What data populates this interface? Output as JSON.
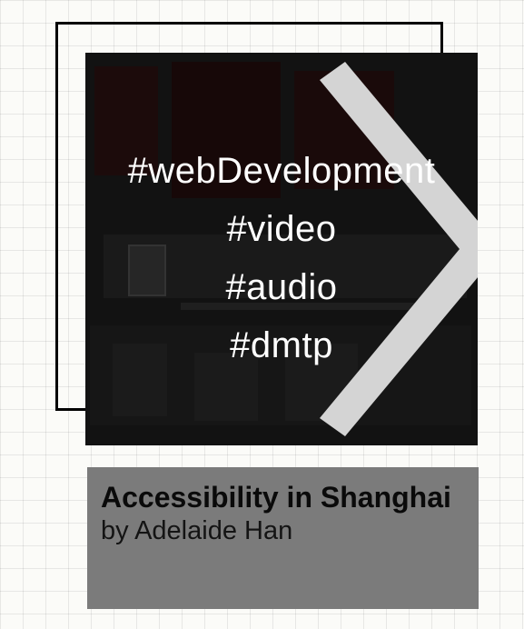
{
  "card": {
    "tags": [
      "#webDevelopment",
      "#video",
      "#audio",
      "#dmtp"
    ]
  },
  "info": {
    "title": "Accessibility in Shanghai",
    "author": "by Adelaide Han"
  },
  "colors": {
    "card_background": "#121212",
    "info_background": "#7b7b7b",
    "chevron": "#d4d4d4",
    "grid_background": "#fbfbf8"
  },
  "icons": {
    "arrow": "chevron-right-icon"
  }
}
